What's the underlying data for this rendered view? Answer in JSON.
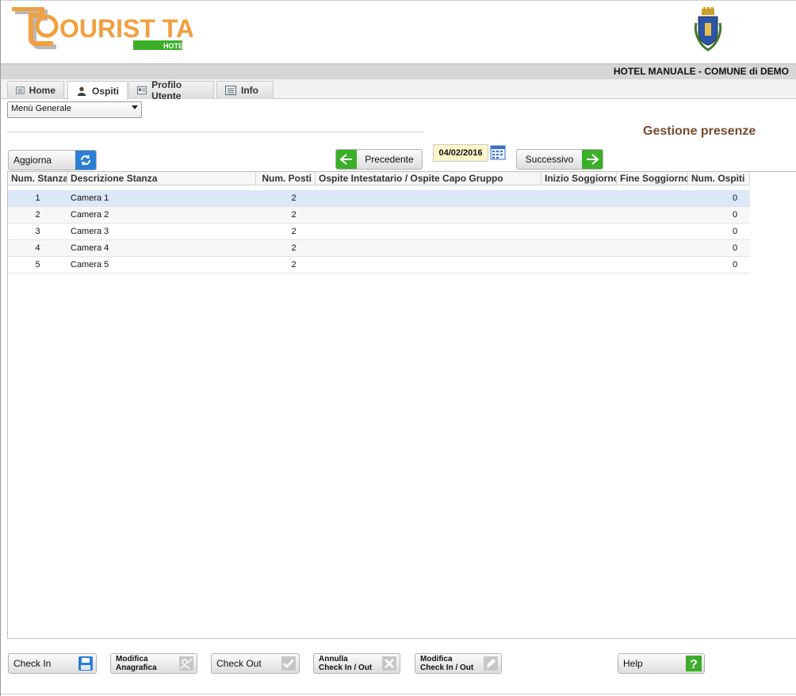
{
  "header": {
    "logo_text": "OURIST TAX",
    "logo_sub": "HOTEL",
    "context_title": "HOTEL MANUALE - COMUNE di DEMO"
  },
  "tabs": [
    {
      "label": "Home",
      "icon": "list-icon",
      "active": false
    },
    {
      "label": "Ospiti",
      "icon": "user-icon",
      "active": true
    },
    {
      "label": "Profilo Utente",
      "icon": "id-card-icon",
      "active": false
    },
    {
      "label": "Info",
      "icon": "list-icon",
      "active": false
    }
  ],
  "menu": {
    "selected": "Menù Generale"
  },
  "page_title": "Gestione presenze",
  "toolbar": {
    "refresh_label": "Aggiorna",
    "prev_label": "Precedente",
    "date": "04/02/2016",
    "next_label": "Successivo"
  },
  "table": {
    "columns": [
      "Num. Stanza",
      "Descrizione Stanza",
      "Num. Posti",
      "Ospite Intestatario / Ospite Capo Gruppo",
      "Inizio Soggiorno",
      "Fine Soggiorno",
      "Num. Ospiti"
    ],
    "rows": [
      [
        "1",
        "Camera 1",
        "2",
        "",
        "",
        "",
        "0"
      ],
      [
        "2",
        "Camera 2",
        "2",
        "",
        "",
        "",
        "0"
      ],
      [
        "3",
        "Camera 3",
        "2",
        "",
        "",
        "",
        "0"
      ],
      [
        "4",
        "Camera 4",
        "2",
        "",
        "",
        "",
        "0"
      ],
      [
        "5",
        "Camera 5",
        "2",
        "",
        "",
        "",
        "0"
      ]
    ]
  },
  "footer": {
    "checkin_label": "Check In",
    "modifica_anagrafica_line1": "Modifica",
    "modifica_anagrafica_line2": "Anagrafica",
    "checkout_label": "Check Out",
    "annulla_line1": "Annulla",
    "annulla_line2": "Check In / Out",
    "modifica_check_line1": "Modifica",
    "modifica_check_line2": "Check In / Out",
    "help_label": "Help"
  },
  "colors": {
    "accent_green": "#3cae2a",
    "accent_blue": "#2a7fd4",
    "logo_orange": "#f0a040",
    "title_brown": "#7a4a2e",
    "selected_row": "#dce7f7"
  }
}
